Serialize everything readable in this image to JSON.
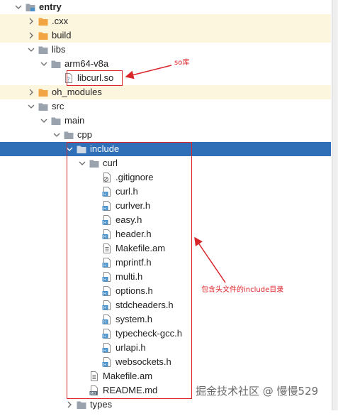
{
  "tree": [
    {
      "label": "entry",
      "depth": 0,
      "expanded": true,
      "icon": "module-folder-icon",
      "bold": true
    },
    {
      "label": ".cxx",
      "depth": 1,
      "expanded": false,
      "icon": "folder-orange-icon",
      "band": "yellow"
    },
    {
      "label": "build",
      "depth": 1,
      "expanded": false,
      "icon": "folder-orange-icon",
      "band": "yellow"
    },
    {
      "label": "libs",
      "depth": 1,
      "expanded": true,
      "icon": "folder-icon"
    },
    {
      "label": "arm64-v8a",
      "depth": 2,
      "expanded": true,
      "icon": "folder-icon"
    },
    {
      "label": "libcurl.so",
      "depth": 3,
      "icon": "unknown-file-icon"
    },
    {
      "label": "oh_modules",
      "depth": 1,
      "expanded": false,
      "icon": "folder-orange-icon",
      "band": "yellow"
    },
    {
      "label": "src",
      "depth": 1,
      "expanded": true,
      "icon": "folder-icon"
    },
    {
      "label": "main",
      "depth": 2,
      "expanded": true,
      "icon": "folder-icon"
    },
    {
      "label": "cpp",
      "depth": 3,
      "expanded": true,
      "icon": "folder-icon"
    },
    {
      "label": "include",
      "depth": 4,
      "expanded": true,
      "icon": "folder-icon",
      "selected": true
    },
    {
      "label": "curl",
      "depth": 5,
      "expanded": true,
      "icon": "folder-icon"
    },
    {
      "label": ".gitignore",
      "depth": 6,
      "icon": "gitignore-file-icon"
    },
    {
      "label": "curl.h",
      "depth": 6,
      "icon": "header-file-icon"
    },
    {
      "label": "curlver.h",
      "depth": 6,
      "icon": "header-file-icon"
    },
    {
      "label": "easy.h",
      "depth": 6,
      "icon": "header-file-icon"
    },
    {
      "label": "header.h",
      "depth": 6,
      "icon": "header-file-icon"
    },
    {
      "label": "Makefile.am",
      "depth": 6,
      "icon": "text-file-icon"
    },
    {
      "label": "mprintf.h",
      "depth": 6,
      "icon": "header-file-icon"
    },
    {
      "label": "multi.h",
      "depth": 6,
      "icon": "header-file-icon"
    },
    {
      "label": "options.h",
      "depth": 6,
      "icon": "header-file-icon"
    },
    {
      "label": "stdcheaders.h",
      "depth": 6,
      "icon": "header-file-icon"
    },
    {
      "label": "system.h",
      "depth": 6,
      "icon": "header-file-icon"
    },
    {
      "label": "typecheck-gcc.h",
      "depth": 6,
      "icon": "header-file-icon"
    },
    {
      "label": "urlapi.h",
      "depth": 6,
      "icon": "header-file-icon"
    },
    {
      "label": "websockets.h",
      "depth": 6,
      "icon": "header-file-icon"
    },
    {
      "label": "Makefile.am",
      "depth": 5,
      "icon": "text-file-icon"
    },
    {
      "label": "README.md",
      "depth": 5,
      "icon": "markdown-file-icon"
    },
    {
      "label": "types",
      "depth": 4,
      "expanded": false,
      "icon": "folder-icon"
    }
  ],
  "annotations": {
    "so_label": "so库",
    "include_label": "包含头文件的include目录"
  },
  "watermark": "掘金技术社区 @ 慢慢529",
  "colors": {
    "selection": "#2f6fb8",
    "excluded_band": "#fdf6df",
    "annotation_red": "#d9262b",
    "folder_orange": "#f2a443",
    "folder_gray": "#9aa3ad",
    "header_blue": "#4a90c8"
  }
}
